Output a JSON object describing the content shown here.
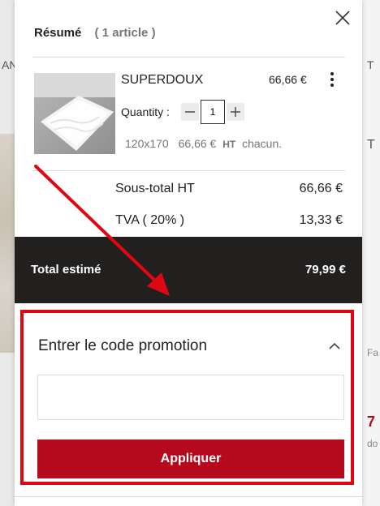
{
  "background": {
    "left_text": "AN",
    "right_texts": [
      "T",
      "T",
      "Fa",
      "7",
      "do"
    ]
  },
  "cart": {
    "title": "Résumé",
    "count": "( 1 article )",
    "item": {
      "name": "SUPERDOUX",
      "price": "66,66 €",
      "quantity_label": "Quantity :",
      "quantity": "1",
      "size": "120x170",
      "unit_price": "66,66 €",
      "tax_label": "HT",
      "unit_suffix": "chacun."
    },
    "subtotal_label": "Sous-total HT",
    "subtotal_value": "66,66 €",
    "tva_label": "TVA ( 20% )",
    "tva_value": "13,33 €",
    "total_label": "Total estimé",
    "total_value": "79,99 €"
  },
  "promo": {
    "title": "Entrer le code promotion",
    "input_value": "",
    "apply_label": "Appliquer"
  },
  "colors": {
    "accent": "#b50a1e",
    "highlight": "#e00712",
    "total_bar": "#221f1f"
  }
}
